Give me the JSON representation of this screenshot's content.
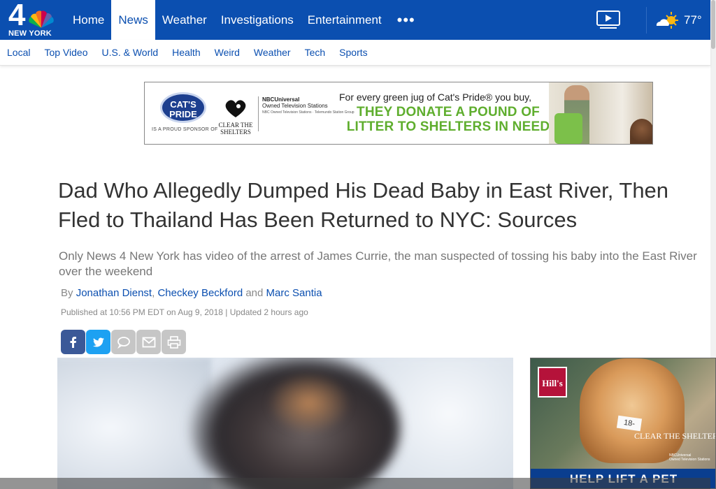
{
  "header": {
    "logo": {
      "number": "4",
      "station_name": "NEW YORK",
      "icon": "nbc-peacock-icon"
    },
    "main_nav": [
      {
        "label": "Home",
        "active": false
      },
      {
        "label": "News",
        "active": true
      },
      {
        "label": "Weather",
        "active": false
      },
      {
        "label": "Investigations",
        "active": false
      },
      {
        "label": "Entertainment",
        "active": false
      }
    ],
    "more_label": "•••",
    "video_icon": "video-play-icon",
    "weather": {
      "icon": "partly-sunny-icon",
      "temp": "77°"
    }
  },
  "sub_nav": [
    "Local",
    "Top Video",
    "U.S. & World",
    "Health",
    "Weird",
    "Weather",
    "Tech",
    "Sports"
  ],
  "banner_ad": {
    "brand_logo": "CAT'S PRIDE",
    "sponsor_text": "IS A PROUD SPONSOR OF",
    "clear_label": "CLEAR THE SHELTERS",
    "nbcu_line1": "NBCUniversal",
    "nbcu_line2": "Owned Television Stations",
    "nbcu_line3": "NBC Owned Television Stations · Telemundo Station Group",
    "headline": "For every green jug of Cat's Pride® you buy,",
    "green_line1": "THEY DONATE A POUND OF",
    "green_line2": "LITTER TO SHELTERS IN NEED"
  },
  "article": {
    "title_line1": "Dad Who Allegedly Dumped His Dead Baby in East River, Then",
    "title_line2": "Fled to Thailand Has Been Returned to NYC: Sources",
    "dek_line1": "Only News 4 New York has video of the arrest of James Currie, the man suspected of tossing his baby into the East River",
    "dek_line2": "over the weekend",
    "byline": {
      "prefix": "By",
      "author1": "Jonathan Dienst",
      "sep1": ",",
      "author2": "Checkey Beckford",
      "sep2": "and",
      "author3": "Marc Santia"
    },
    "published": "Published at 10:56 PM EDT on Aug 9, 2018 | Updated 2 hours ago"
  },
  "share_buttons": [
    "facebook-icon",
    "twitter-icon",
    "comment-icon",
    "email-icon",
    "print-icon"
  ],
  "side_ad": {
    "brand": "Hill's",
    "tag_text": "18-",
    "clear_label": "CLEAR THE SHELTERS",
    "nbcu_line1": "NBCUniversal",
    "nbcu_line2": "Owned Television Stations",
    "cta": "HELP LIFT A PET"
  },
  "colors": {
    "brand_blue": "#0b4fb0",
    "link_blue": "#0b4fb0",
    "facebook": "#3b5998",
    "twitter": "#1da1f2",
    "ad_green": "#5fae2e"
  }
}
